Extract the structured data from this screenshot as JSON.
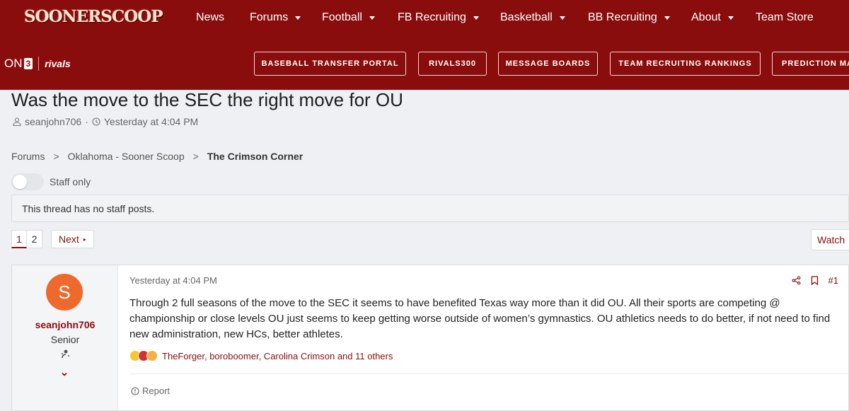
{
  "site": {
    "logo": "SOONERSCOOP",
    "nav": [
      {
        "label": "News",
        "has_menu": false
      },
      {
        "label": "Forums",
        "has_menu": true
      },
      {
        "label": "Football",
        "has_menu": true
      },
      {
        "label": "FB Recruiting",
        "has_menu": true
      },
      {
        "label": "Basketball",
        "has_menu": true
      },
      {
        "label": "BB Recruiting",
        "has_menu": true
      },
      {
        "label": "About",
        "has_menu": true
      },
      {
        "label": "Team Store",
        "has_menu": false
      }
    ],
    "network": {
      "on3": "ON",
      "on3_num": "3",
      "rivals": "rivals"
    },
    "quick_links": [
      "BASEBALL TRANSFER PORTAL",
      "RIVALS300",
      "MESSAGE BOARDS",
      "TEAM RECRUITING RANKINGS",
      "PREDICTION MA"
    ],
    "brand_color": "#8a0d0d"
  },
  "thread": {
    "title": "Was the move to the SEC the right move for OU",
    "author": "seanjohn706",
    "separator": "·",
    "posted": "Yesterday at 4:04 PM"
  },
  "breadcrumbs": [
    "Forums",
    "Oklahoma - Sooner Scoop",
    "The Crimson Corner"
  ],
  "staff_toggle": {
    "label": "Staff only",
    "on": false
  },
  "notice": "This thread has no staff posts.",
  "pagination": {
    "pages": [
      "1",
      "2"
    ],
    "current": "1",
    "next_label": "Next",
    "watch_label": "Watch"
  },
  "post": {
    "user": {
      "initial": "S",
      "name": "seanjohn706",
      "rank": "Senior",
      "avatar_color": "#f0692c"
    },
    "date": "Yesterday at 4:04 PM",
    "number": "#1",
    "body": "Through 2 full seasons of the move to the SEC it seems to have benefited Texas way more than it did OU. All their sports are competing @ championship or close levels OU just seems to keep getting worse outside of women’s gymnastics. OU athletics needs to do better, if not need to find new administration, new HCs, better athletes.",
    "reactions_text": "TheForger, boroboomer, Carolina Crimson and 11 others",
    "report_label": "Report"
  }
}
